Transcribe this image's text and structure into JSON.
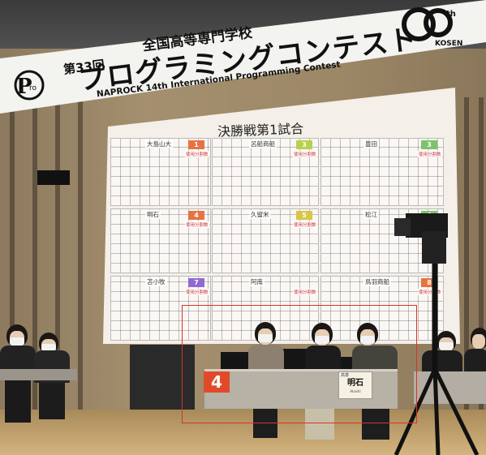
{
  "banner": {
    "school": "全国高等専門学校",
    "edition": "第33回",
    "title": "プログラミングコンテスト",
    "subtitle": "NAPROCK 14th International Programming Contest",
    "logo_left_text": "Pro",
    "logo_right_text": "60th KOSEN"
  },
  "screen": {
    "title": "決勝戦第1試合",
    "panels": [
      {
        "name": "大島山大",
        "number": "1",
        "color": "#e67342"
      },
      {
        "name": "呂船商船",
        "number": "3",
        "color": "#b7d24a"
      },
      {
        "name": "豊田",
        "number": "3",
        "color": "#7cc36a"
      },
      {
        "name": "明石",
        "number": "4",
        "color": "#e67342"
      },
      {
        "name": "久留米",
        "number": "5",
        "color": "#d8c64a"
      },
      {
        "name": "松江",
        "number": "6",
        "color": "#7cc36a"
      },
      {
        "name": "苫小牧",
        "number": "7",
        "color": "#8f6ad2"
      },
      {
        "name": "阿南",
        "number": "",
        "color": "#e67342"
      },
      {
        "name": "鳥羽商船",
        "number": "8",
        "color": "#e67342"
      }
    ],
    "tag": "使用分割数"
  },
  "stage": {
    "team_number": "4",
    "name_card_top": "高専",
    "name_card_main": "明石",
    "name_card_sub": "Akashi",
    "highlight_color": "#d8342a"
  }
}
